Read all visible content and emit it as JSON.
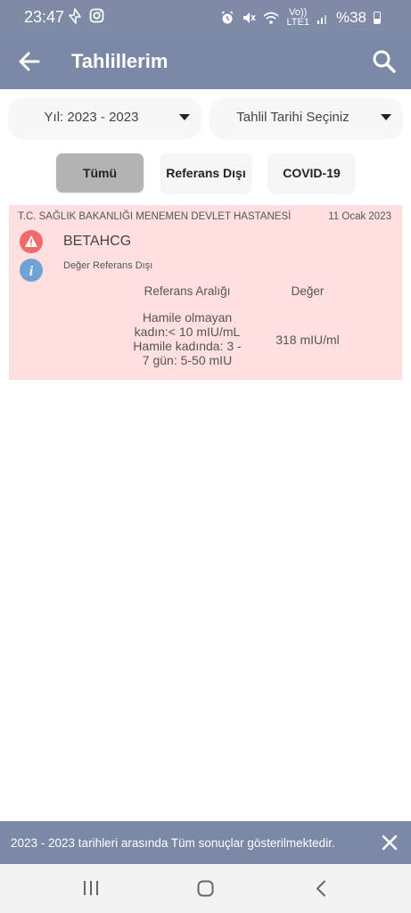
{
  "status_bar": {
    "time": "23:47",
    "battery": "%38",
    "volte": "Vo))",
    "lte": "LTE1"
  },
  "app_bar": {
    "title": "Tahlillerim",
    "icons": {
      "back": "arrow-left-icon",
      "search": "search-icon"
    }
  },
  "filters": {
    "year_dropdown": "Yıl: 2023 - 2023",
    "date_dropdown": "Tahlil Tarihi Seçiniz",
    "buttons": {
      "all": "Tümü",
      "out_of_range": "Referans Dışı",
      "covid": "COVID-19"
    }
  },
  "results": [
    {
      "hospital": "T.C. SAĞLIK BAKANLIĞI MENEMEN DEVLET HASTANESİ",
      "date": "11 Ocak 2023",
      "test_name": "BETAHCG",
      "status": "Değer Referans Dışı",
      "reference_header": "Referans Aralığı",
      "value_header": "Değer",
      "reference_range_lines": [
        "Hamile olmayan",
        "kadın:< 10 mIU/mL",
        "Hamile kadında: 3 -",
        "7 gün: 5-50 mIU"
      ],
      "value": "318 mIU/ml"
    }
  ],
  "snackbar": {
    "text": "2023 - 2023 tarihleri arasında Tüm sonuçlar gösterilmektedir."
  },
  "colors": {
    "app_bar": "#7c89a6",
    "card_background": "#ffdfdf",
    "warning": "#ef6b6b",
    "info": "#6fa3d6",
    "selected_filter": "#b3b3b3"
  }
}
